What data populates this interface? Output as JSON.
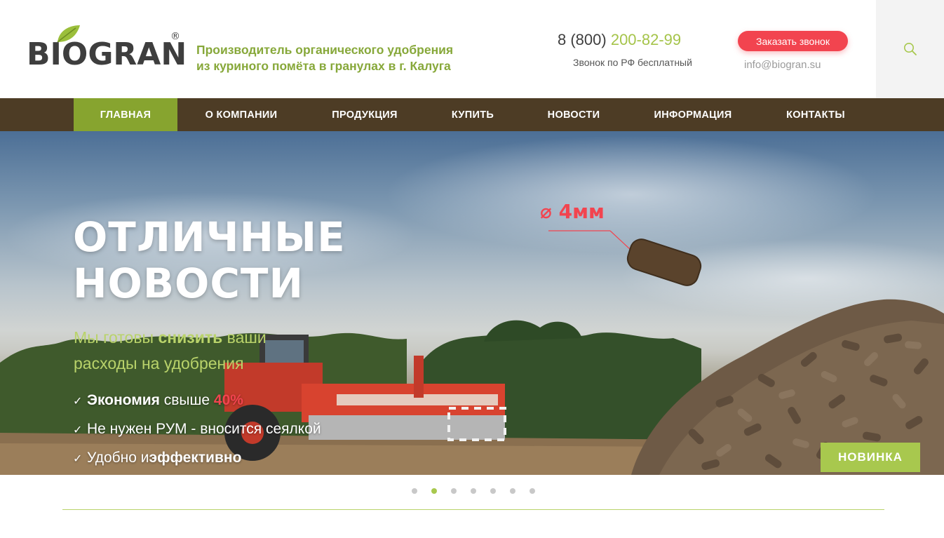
{
  "header": {
    "logo_text": "BIOGRAN",
    "logo_reg": "®",
    "tagline_line1": "Производитель органического удобрения",
    "tagline_line2": "из куриного помёта в гранулах в г. Калуга",
    "phone_prefix": "8 (800) ",
    "phone_number": "200-82-99",
    "phone_note": "Звонок по РФ бесплатный",
    "callback_label": "Заказать звонок",
    "email": "info@biogran.su",
    "search_icon": "search-icon"
  },
  "nav": {
    "items": [
      {
        "label": "ГЛАВНАЯ",
        "active": true
      },
      {
        "label": "О КОМПАНИИ",
        "active": false
      },
      {
        "label": "ПРОДУКЦИЯ",
        "active": false
      },
      {
        "label": "КУПИТЬ",
        "active": false
      },
      {
        "label": "НОВОСТИ",
        "active": false
      },
      {
        "label": "ИНФОРМАЦИЯ",
        "active": false
      },
      {
        "label": "КОНТАКТЫ",
        "active": false
      }
    ]
  },
  "hero": {
    "title_line1": "ОТЛИЧНЫЕ",
    "title_line2": "НОВОСТИ",
    "sub_pre": "Мы готовы ",
    "sub_bold": "снизить",
    "sub_post": " ваши",
    "sub_line2": "расходы на удобрения",
    "list": [
      {
        "bold": "Экономия",
        "text": " свыше ",
        "red": "40%"
      },
      {
        "text": "Не нужен РУМ - вносится сеялкой"
      },
      {
        "text": "Удобно и",
        "bold": "эффективно"
      }
    ],
    "check_mark": "✓",
    "pellet_label": "⌀ 4мм",
    "badge": "НОВИНКА"
  },
  "slider": {
    "dot_count": 7,
    "active_index": 1
  },
  "colors": {
    "brand_green": "#87a42f",
    "light_green": "#a8c84e",
    "nav_brown": "#4d3c25",
    "accent_red": "#f2444f"
  }
}
